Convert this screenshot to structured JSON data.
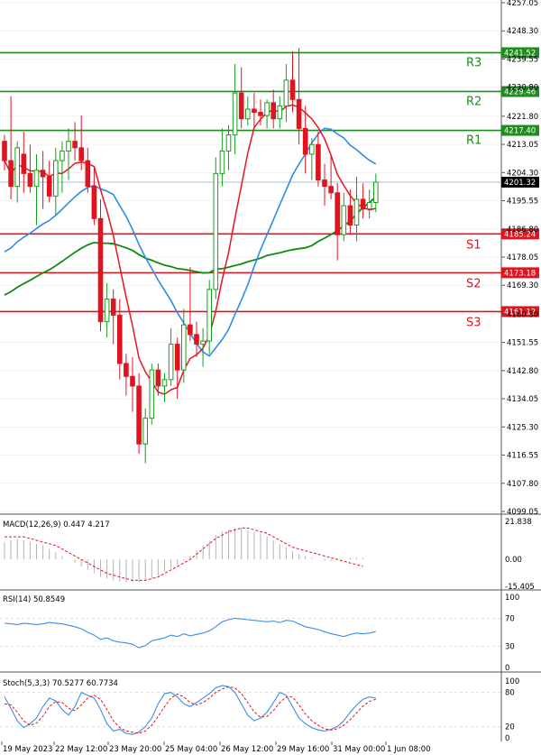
{
  "colors": {
    "up": "#14a01e",
    "down": "#e0141e",
    "resistance": "#1e8c1e",
    "support": "#e0141e",
    "ma_fast": "#e8141e",
    "ma_mid": "#2d8ce6",
    "ma_slow": "#0f8c0f",
    "price_line": "#9bb3d8",
    "grid": "#888888",
    "macd_hist": "#b4b4b4",
    "macd_signal": "#e0141e",
    "rsi": "#3a8ee6",
    "stoch_k": "#3a8ee6",
    "stoch_d": "#e0141e"
  },
  "chart_data": {
    "type": "candlestick",
    "symbol_timeframe": "",
    "y_ticks": [
      "4257.05",
      "4248.30",
      "4239.55",
      "4230.80",
      "4221.80",
      "4213.05",
      "4204.30",
      "4195.55",
      "4186.80",
      "4178.05",
      "4169.30",
      "4160.30",
      "4151.55",
      "4142.80",
      "4134.05",
      "4125.30",
      "4116.55",
      "4107.80",
      "4099.05"
    ],
    "ylim": [
      4099.05,
      4257.05
    ],
    "x_ticks": [
      "19 May 2023",
      "22 May 12:00",
      "23 May 20:00",
      "25 May 04:00",
      "26 May 12:00",
      "29 May 16:00",
      "31 May 00:00",
      "1 Jun 08:00"
    ],
    "last_price": 4201.32,
    "levels": [
      {
        "name": "R3",
        "value": 4241.52,
        "kind": "resistance"
      },
      {
        "name": "R2",
        "value": 4229.46,
        "kind": "resistance"
      },
      {
        "name": "R1",
        "value": 4217.4,
        "kind": "resistance"
      },
      {
        "name": "S1",
        "value": 4185.24,
        "kind": "support"
      },
      {
        "name": "S2",
        "value": 4173.18,
        "kind": "support"
      },
      {
        "name": "S3",
        "value": 4161.12,
        "kind": "support"
      }
    ],
    "candles": [
      [
        4214,
        4216,
        4205,
        4208
      ],
      [
        4208,
        4228,
        4196,
        4200
      ],
      [
        4200,
        4214,
        4195,
        4212
      ],
      [
        4210,
        4217,
        4198,
        4204
      ],
      [
        4204,
        4213,
        4198,
        4200
      ],
      [
        4200,
        4210,
        4188,
        4205
      ],
      [
        4205,
        4211,
        4193,
        4203
      ],
      [
        4203,
        4208,
        4195,
        4197
      ],
      [
        4197,
        4212,
        4191,
        4208
      ],
      [
        4208,
        4214,
        4198,
        4211
      ],
      [
        4211,
        4218,
        4202,
        4214
      ],
      [
        4214,
        4220,
        4208,
        4212
      ],
      [
        4212,
        4222,
        4205,
        4208
      ],
      [
        4208,
        4212,
        4198,
        4200
      ],
      [
        4200,
        4206,
        4188,
        4190
      ],
      [
        4190,
        4196,
        4155,
        4158
      ],
      [
        4158,
        4170,
        4153,
        4165
      ],
      [
        4165,
        4168,
        4151,
        4160
      ],
      [
        4160,
        4165,
        4140,
        4145
      ],
      [
        4145,
        4148,
        4135,
        4141
      ],
      [
        4141,
        4147,
        4130,
        4138
      ],
      [
        4138,
        4142,
        4117,
        4120
      ],
      [
        4120,
        4131,
        4114,
        4128
      ],
      [
        4128,
        4145,
        4126,
        4143
      ],
      [
        4143,
        4145,
        4135,
        4138
      ],
      [
        4138,
        4142,
        4133,
        4140
      ],
      [
        4140,
        4156,
        4138,
        4151
      ],
      [
        4151,
        4153,
        4134,
        4143
      ],
      [
        4143,
        4162,
        4139,
        4157
      ],
      [
        4157,
        4175,
        4152,
        4154
      ],
      [
        4154,
        4158,
        4147,
        4151
      ],
      [
        4151,
        4156,
        4144,
        4152
      ],
      [
        4152,
        4171,
        4148,
        4168
      ],
      [
        4168,
        4209,
        4165,
        4204
      ],
      [
        4204,
        4218,
        4200,
        4211
      ],
      [
        4211,
        4219,
        4205,
        4216
      ],
      [
        4216,
        4238,
        4210,
        4229
      ],
      [
        4229,
        4237,
        4218,
        4221
      ],
      [
        4221,
        4228,
        4219,
        4224
      ],
      [
        4224,
        4229,
        4218,
        4223
      ],
      [
        4223,
        4227,
        4219,
        4222
      ],
      [
        4222,
        4227,
        4218,
        4226
      ],
      [
        4226,
        4230,
        4218,
        4221
      ],
      [
        4221,
        4228,
        4218,
        4225
      ],
      [
        4225,
        4238,
        4220,
        4233
      ],
      [
        4233,
        4242,
        4223,
        4227
      ],
      [
        4227,
        4243,
        4213,
        4218
      ],
      [
        4218,
        4225,
        4204,
        4210
      ],
      [
        4210,
        4215,
        4202,
        4213
      ],
      [
        4213,
        4217,
        4200,
        4202
      ],
      [
        4202,
        4207,
        4194,
        4200
      ],
      [
        4200,
        4210,
        4196,
        4198
      ],
      [
        4198,
        4201,
        4177,
        4185
      ],
      [
        4185,
        4198,
        4183,
        4194
      ],
      [
        4194,
        4199,
        4185,
        4188
      ],
      [
        4188,
        4203,
        4183,
        4196
      ],
      [
        4196,
        4201,
        4190,
        4193
      ],
      [
        4193,
        4199,
        4190,
        4195
      ],
      [
        4195,
        4204,
        4192,
        4201.3
      ]
    ],
    "macd_label": "MACD(12,26,9) 0.447 4.217",
    "macd_ticks": [
      "21.838",
      "0.00",
      "-15.405"
    ],
    "macd_hist": [
      10,
      11,
      12,
      11,
      10,
      9,
      8,
      6,
      4,
      2,
      0,
      -2,
      -4,
      -6,
      -8,
      -10,
      -11,
      -12,
      -13,
      -13,
      -13,
      -13,
      -12,
      -11,
      -9,
      -7,
      -5,
      -3,
      -1,
      2,
      5,
      8,
      11,
      14,
      16,
      17,
      18,
      18,
      17,
      16,
      15,
      13,
      11,
      9,
      7,
      5,
      3,
      2,
      1,
      0,
      -1,
      -1,
      0,
      0,
      1,
      1,
      1
    ],
    "macd_signal": [
      13,
      13,
      13,
      13,
      12,
      11,
      10,
      9,
      8,
      6,
      4,
      2,
      0,
      -2,
      -4,
      -6,
      -8,
      -9,
      -10,
      -11,
      -12,
      -12,
      -12,
      -11,
      -10,
      -8,
      -6,
      -4,
      -2,
      0,
      3,
      6,
      9,
      12,
      14,
      16,
      17,
      18,
      18,
      17,
      16,
      15,
      13,
      11,
      9,
      7,
      6,
      5,
      4,
      3,
      2,
      1,
      0,
      -1,
      -2,
      -3,
      -4
    ],
    "rsi_label": "RSI(14) 50.8549",
    "rsi_ticks": [
      "100",
      "70",
      "30",
      "0"
    ],
    "rsi": [
      63,
      62,
      61,
      63,
      62,
      61,
      62,
      64,
      63,
      62,
      60,
      58,
      55,
      50,
      46,
      40,
      42,
      38,
      36,
      35,
      33,
      28,
      31,
      38,
      40,
      42,
      46,
      44,
      48,
      45,
      47,
      49,
      52,
      58,
      65,
      68,
      70,
      69,
      68,
      67,
      66,
      65,
      66,
      64,
      67,
      66,
      62,
      58,
      56,
      54,
      51,
      48,
      46,
      44,
      47,
      49,
      48,
      49,
      51
    ],
    "stoch_label": "Stoch(5,3,3) 70.5277 60.7734",
    "stoch_ticks": [
      "100",
      "80",
      "20",
      "0"
    ],
    "stoch_k": [
      72,
      52,
      30,
      18,
      25,
      35,
      55,
      70,
      65,
      50,
      40,
      55,
      80,
      75,
      70,
      50,
      25,
      12,
      15,
      8,
      6,
      10,
      20,
      35,
      60,
      78,
      80,
      72,
      60,
      55,
      62,
      70,
      78,
      88,
      92,
      90,
      80,
      60,
      40,
      30,
      35,
      45,
      62,
      80,
      75,
      55,
      35,
      25,
      18,
      14,
      12,
      15,
      20,
      30,
      45,
      58,
      68,
      72,
      70
    ],
    "stoch_d": [
      60,
      58,
      45,
      30,
      22,
      26,
      38,
      55,
      64,
      62,
      52,
      48,
      58,
      70,
      75,
      68,
      50,
      30,
      18,
      12,
      10,
      8,
      12,
      22,
      38,
      55,
      70,
      77,
      72,
      62,
      58,
      62,
      70,
      80,
      86,
      90,
      88,
      78,
      62,
      46,
      36,
      38,
      48,
      62,
      72,
      72,
      58,
      42,
      30,
      22,
      16,
      14,
      16,
      22,
      32,
      44,
      56,
      64,
      68
    ]
  }
}
